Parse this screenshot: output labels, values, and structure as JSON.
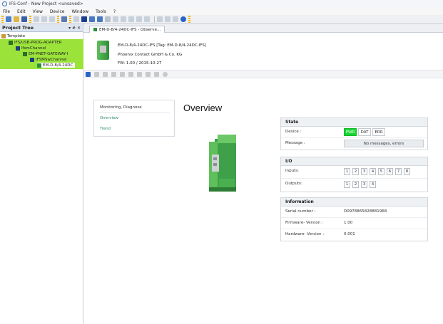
{
  "window": {
    "title": "IFS-Conf - New Project <unsaved>"
  },
  "menu": [
    "File",
    "Edit",
    "View",
    "Device",
    "Window",
    "Tools",
    "?"
  ],
  "project_tree": {
    "title": "Project Tree",
    "controls": "▾ # ✕",
    "items": [
      {
        "label": "Template"
      },
      {
        "label": "IFS/USB-PROG-ADAPTER"
      },
      {
        "label": "IfsmChannel"
      },
      {
        "label": "EM-PNET-GATEWAY-I"
      },
      {
        "label": "IFSMSwChannel"
      },
      {
        "label": "EM-D-8/4-24DC"
      }
    ]
  },
  "doc_tab": {
    "label": "EM-D-8/4-24DC-IFS - Observe..."
  },
  "device_info": {
    "line1": "EM-D-8/4-24DC-IFS [Tag: EM-D-8/4-24DC-IFS]",
    "line2": "Phoenix Contact GmbH & Co. KG",
    "line3": "FW: 1.00 / 2015-10-27"
  },
  "nav": {
    "items": [
      {
        "label": "Monitoring, Diagnose"
      },
      {
        "label": "Overview"
      },
      {
        "label": "Trend"
      }
    ]
  },
  "overview_title": "Overview",
  "state": {
    "header": "State",
    "device_label": "Device :",
    "leds": [
      {
        "label": "PWR",
        "on": true
      },
      {
        "label": "DAT",
        "on": false
      },
      {
        "label": "ERR",
        "on": false
      }
    ],
    "message_label": "Message :",
    "message_value": "No messages, errors"
  },
  "io": {
    "header": "I/O",
    "inputs_label": "Inputs:",
    "inputs": [
      "1",
      "2",
      "3",
      "4",
      "5",
      "6",
      "7",
      "8"
    ],
    "outputs_label": "Outputs:",
    "outputs": [
      "1",
      "2",
      "3",
      "4"
    ]
  },
  "information": {
    "header": "Information",
    "serial_label": "Serial number :",
    "serial_value": "D0978865828881968",
    "firmware_label": "Firmware- Version :",
    "firmware_value": "1.00",
    "hardware_label": "Hardware- Version :",
    "hardware_value": "0.001"
  },
  "colors": {
    "tree_highlight": "#9be33a",
    "led_on": "#18d631",
    "link": "#2a8a6a"
  }
}
